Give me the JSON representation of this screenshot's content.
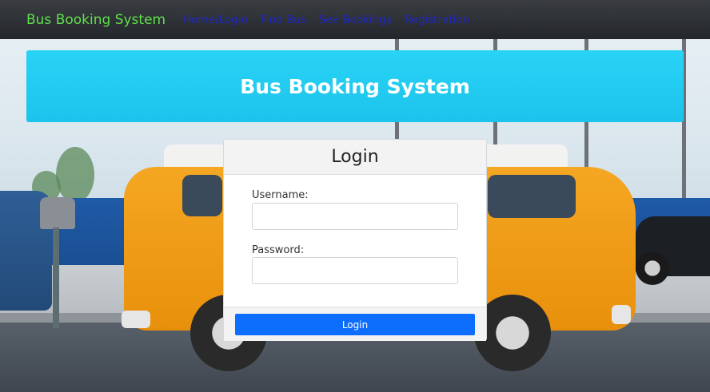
{
  "nav": {
    "brand": "Bus Booking System",
    "links": [
      "Home/Login",
      "Find Bus",
      "See Bookings",
      "Registration"
    ]
  },
  "banner": {
    "title": "Bus Booking System"
  },
  "login": {
    "title": "Login",
    "username_label": "Username:",
    "username_value": "",
    "password_label": "Password:",
    "password_value": "",
    "button_label": "Login"
  },
  "colors": {
    "navbar": "#2b2e33",
    "brand": "#5fe04a",
    "nav_link": "#1f27c9",
    "banner": "#22cbf1",
    "button": "#0d6efd"
  }
}
